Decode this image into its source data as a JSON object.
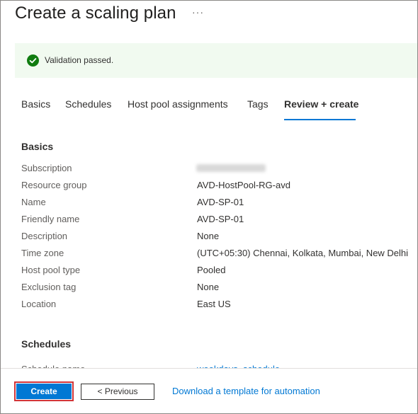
{
  "header": {
    "title": "Create a scaling plan",
    "more": "···"
  },
  "validation": {
    "message": "Validation passed.",
    "status_color": "#107c10"
  },
  "tabs": [
    {
      "label": "Basics",
      "active": false
    },
    {
      "label": "Schedules",
      "active": false
    },
    {
      "label": "Host pool assignments",
      "active": false
    },
    {
      "label": "Tags",
      "active": false
    },
    {
      "label": "Review + create",
      "active": true
    }
  ],
  "basics": {
    "heading": "Basics",
    "rows": [
      {
        "label": "Subscription",
        "value": ""
      },
      {
        "label": "Resource group",
        "value": "AVD-HostPool-RG-avd"
      },
      {
        "label": "Name",
        "value": "AVD-SP-01"
      },
      {
        "label": "Friendly name",
        "value": "AVD-SP-01"
      },
      {
        "label": "Description",
        "value": "None"
      },
      {
        "label": "Time zone",
        "value": "(UTC+05:30) Chennai, Kolkata, Mumbai, New Delhi"
      },
      {
        "label": "Host pool type",
        "value": "Pooled"
      },
      {
        "label": "Exclusion tag",
        "value": "None"
      },
      {
        "label": "Location",
        "value": "East US"
      }
    ]
  },
  "schedules": {
    "heading": "Schedules",
    "partial_label": "Schedule name",
    "partial_value": "weekdays_schedule"
  },
  "footer": {
    "create_label": "Create",
    "previous_label": "< Previous",
    "download_label": "Download a template for automation"
  },
  "colors": {
    "accent": "#0078d4",
    "highlight": "#d13438",
    "validation_bg": "#f1faf0"
  }
}
